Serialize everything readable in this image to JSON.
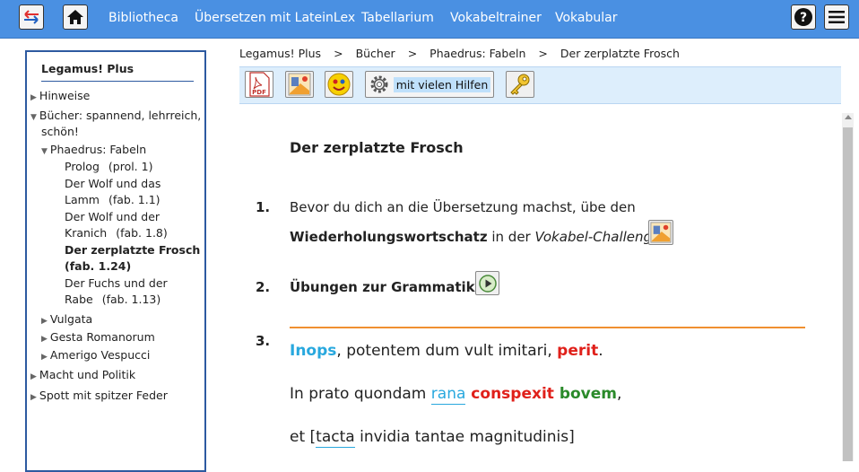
{
  "nav": {
    "links": [
      "Bibliotheca",
      "Übersetzen mit LateinLex",
      "Tabellarium",
      "Vokabeltrainer",
      "Vokabular"
    ],
    "help_icon": "question-mark-icon",
    "menu_icon": "hamburger-menu-icon"
  },
  "sidebar": {
    "title": "Legamus! Plus",
    "items": {
      "hinweise": "Hinweise",
      "buecher_1": "Bücher: spannend, lehrreich,",
      "buecher_2": "schön!",
      "phaedrus": "Phaedrus: Fabeln",
      "prolog": "Prolog",
      "prolog_ref": "(prol. 1)",
      "wolf_lamm_1": "Der Wolf und das",
      "wolf_lamm_2": "Lamm",
      "wolf_lamm_ref": "(fab. 1.1)",
      "wolf_kranich_1": "Der Wolf und der",
      "wolf_kranich_2": "Kranich",
      "wolf_kranich_ref": "(fab. 1.8)",
      "frosch_1": "Der zerplatzte Frosch",
      "frosch_2": "(fab. 1.24)",
      "fuchs_1": "Der Fuchs und der",
      "fuchs_2": "Rabe",
      "fuchs_ref": "(fab. 1.13)",
      "vulgata": "Vulgata",
      "gesta": "Gesta Romanorum",
      "amerigo": "Amerigo Vespucci",
      "macht": "Macht und Politik",
      "spott": "Spott mit spitzer Feder"
    }
  },
  "breadcrumb": {
    "items": [
      "Legamus! Plus",
      "Bücher",
      "Phaedrus: Fabeln",
      "Der zerplatzte Frosch"
    ],
    "separator": ">"
  },
  "toolbar": {
    "pdf_label": "PDF",
    "hilfen_label": "mit vielen Hilfen"
  },
  "main": {
    "title": "Der zerplatzte Frosch",
    "step1_num": "1.",
    "step1_text_a": "Bevor du dich an die Übersetzung machst, übe den",
    "step1_bold": "Wiederholungswortschatz",
    "step1_text_b": "in der",
    "step1_italic": "Vokabel-Challenge",
    "step2_num": "2.",
    "step2_text": "Übungen zur Grammatik",
    "step3_num": "3.",
    "line1": {
      "w1": "Inops",
      "w2": ", potentem dum vult imitari, ",
      "w3": "perit",
      "w4": "."
    },
    "line2": {
      "w1": "In prato quondam ",
      "w2": "rana",
      "w3": " conspexit ",
      "w4": "bovem",
      "w5": ","
    },
    "line3": {
      "w1": "et [",
      "w2": "tacta",
      "w3": " invidia tantae magnitudinis]"
    }
  },
  "colors": {
    "nav_bg": "#4a90e2",
    "sidebar_border": "#2d5aa0",
    "toolbar_bg": "#ddeefc",
    "accent_orange": "#f09030",
    "latin_blue": "#28a8de",
    "latin_red": "#e0201a",
    "latin_green": "#2a8a2a"
  }
}
